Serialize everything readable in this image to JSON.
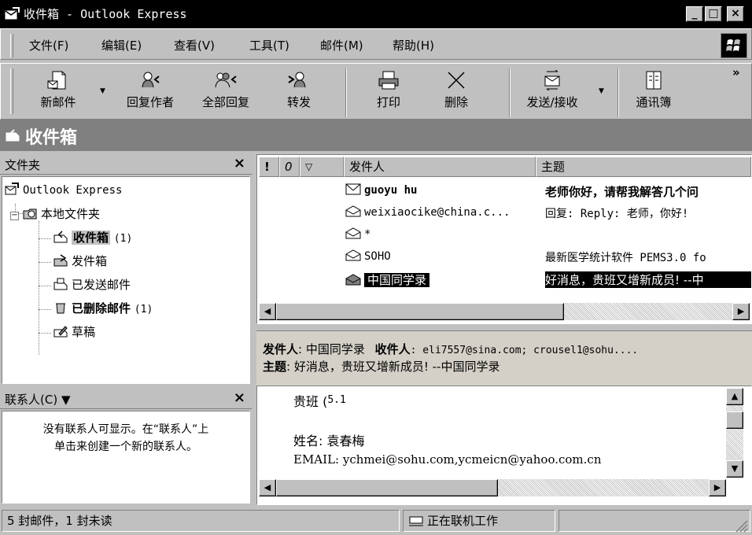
{
  "window": {
    "title": "收件箱 - Outlook Express"
  },
  "menu": [
    "文件(F)",
    "编辑(E)",
    "查看(V)",
    "工具(T)",
    "邮件(M)",
    "帮助(H)"
  ],
  "toolbar": {
    "new_mail": "新邮件",
    "reply": "回复作者",
    "reply_all": "全部回复",
    "forward": "转发",
    "print": "打印",
    "delete": "删除",
    "send_recv": "发送/接收",
    "addresses": "通讯簿",
    "more": "»"
  },
  "folder_header": {
    "title": "收件箱"
  },
  "folder_pane": {
    "header": "文件夹",
    "root": "Outlook Express",
    "local": "本地文件夹",
    "inbox": "收件箱",
    "inbox_count": "(1)",
    "outbox": "发件箱",
    "sent": "已发送邮件",
    "deleted": "已删除邮件",
    "deleted_count": "(1)",
    "drafts": "草稿"
  },
  "contacts_pane": {
    "header": "联系人(C) ▼",
    "line1": "没有联系人可显示。在“联系人”上",
    "line2": "单击来创建一个新的联系人。"
  },
  "message_list": {
    "columns": {
      "priority": "!",
      "attach": "0",
      "flag": "▽",
      "from": "发件人",
      "subject": "主题"
    },
    "rows": [
      {
        "from": "guoyu hu",
        "subject": "老师你好，请帮我解答几个问",
        "unread": true
      },
      {
        "from": "weixiaocike@china.c...",
        "subject": "回复: Reply: 老师，你好!",
        "unread": false
      },
      {
        "from": "*",
        "subject": "",
        "unread": false
      },
      {
        "from": "SOHO",
        "subject": "最新医学统计软件 PEMS3.0 fo",
        "unread": false
      },
      {
        "from": "中国同学录",
        "subject": "好消息，贵班又增新成员! --中",
        "unread": false
      }
    ]
  },
  "preview": {
    "from_label": "发件人",
    "from_value": ": 中国同学录",
    "to_label": "收件人",
    "to_value": ": eli7557@sina.com; crousel1@sohu....",
    "subject_label": "主题",
    "subject_value": ": 好消息，贵班又增新成员! --中国同学录",
    "body": {
      "line1": "贵班 (",
      "line1b": "5.1",
      "line2": "姓名: 袁春梅",
      "line3": "EMAIL: ychmei@sohu.com,ycmeicn@yahoo.com.cn"
    }
  },
  "status": {
    "count": "5 封邮件，1 封未读",
    "online": "正在联机工作"
  }
}
